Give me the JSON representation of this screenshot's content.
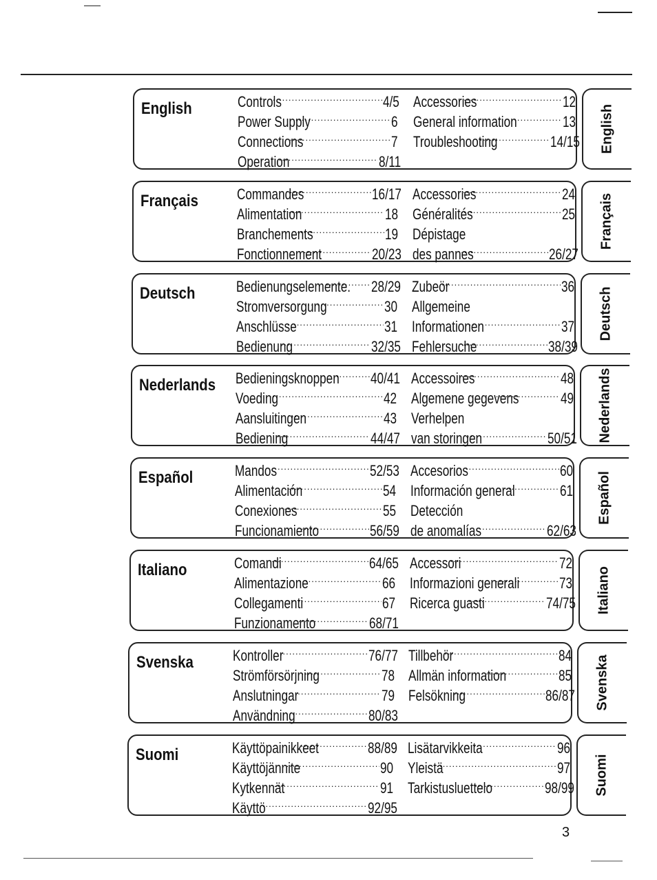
{
  "page_number": "3",
  "sections": [
    {
      "lang": "English",
      "tab": "English",
      "col1": [
        {
          "label": "Controls",
          "page": "4/5"
        },
        {
          "label": "Power Supply",
          "page": "6"
        },
        {
          "label": "Connections",
          "page": "7"
        },
        {
          "label": "Operation",
          "page": "8/11"
        }
      ],
      "col2": [
        {
          "label": "Accessories",
          "page": "12"
        },
        {
          "label": "General information",
          "page": "13"
        },
        {
          "label": "Troubleshooting",
          "page": "14/15"
        }
      ]
    },
    {
      "lang": "Français",
      "tab": "Français",
      "col1": [
        {
          "label": "Commandes",
          "page": "16/17"
        },
        {
          "label": "Alimentation",
          "page": "18"
        },
        {
          "label": "Branchements",
          "page": "19"
        },
        {
          "label": "Fonctionnement",
          "page": "20/23"
        }
      ],
      "col2": [
        {
          "label": "Accessories",
          "page": "24"
        },
        {
          "label": "Généralités",
          "page": "25"
        },
        {
          "label": "Dépistage",
          "page": ""
        },
        {
          "label": "des pannes",
          "page": "26/27"
        }
      ]
    },
    {
      "lang": "Deutsch",
      "tab": "Deutsch",
      "col1": [
        {
          "label": "Bedienungselemente.",
          "page": "28/29"
        },
        {
          "label": "Stromversorgung",
          "page": "30"
        },
        {
          "label": "Anschlüsse",
          "page": "31"
        },
        {
          "label": "Bedienung",
          "page": "32/35"
        }
      ],
      "col2": [
        {
          "label": "Zubeör",
          "page": "36"
        },
        {
          "label": "Allgemeine",
          "page": ""
        },
        {
          "label": "Informationen",
          "page": "37"
        },
        {
          "label": "Fehlersuche",
          "page": "38/39"
        }
      ]
    },
    {
      "lang": "Nederlands",
      "tab": "Nederlands",
      "col1": [
        {
          "label": "Bedieningsknoppen",
          "page": "40/41"
        },
        {
          "label": "Voeding",
          "page": "42"
        },
        {
          "label": "Aansluitingen",
          "page": "43"
        },
        {
          "label": "Bediening",
          "page": "44/47"
        }
      ],
      "col2": [
        {
          "label": "Accessoires",
          "page": "48"
        },
        {
          "label": "Algemene gegevens",
          "page": "49"
        },
        {
          "label": "Verhelpen",
          "page": ""
        },
        {
          "label": "van storingen",
          "page": "50/51"
        }
      ]
    },
    {
      "lang": "Español",
      "tab": "Español",
      "col1": [
        {
          "label": "Mandos",
          "page": "52/53"
        },
        {
          "label": "Alimentación",
          "page": "54"
        },
        {
          "label": "Conexiones",
          "page": "55"
        },
        {
          "label": "Funcionamiento",
          "page": "56/59"
        }
      ],
      "col2": [
        {
          "label": "Accesorios",
          "page": "60"
        },
        {
          "label": "Información general",
          "page": "61"
        },
        {
          "label": "Detección",
          "page": ""
        },
        {
          "label": "de anomalías",
          "page": "62/63"
        }
      ]
    },
    {
      "lang": "Italiano",
      "tab": "Italiano",
      "col1": [
        {
          "label": "Comandi",
          "page": "64/65"
        },
        {
          "label": "Alimentazione",
          "page": "66"
        },
        {
          "label": "Collegamenti",
          "page": "67"
        },
        {
          "label": "Funzionamento",
          "page": "68/71"
        }
      ],
      "col2": [
        {
          "label": "Accessori",
          "page": "72"
        },
        {
          "label": "Informazioni generali",
          "page": "73"
        },
        {
          "label": "Ricerca guasti",
          "page": "74/75"
        }
      ]
    },
    {
      "lang": "Svenska",
      "tab": "Svenska",
      "col1": [
        {
          "label": "Kontroller",
          "page": "76/77"
        },
        {
          "label": "Strömförsörjning",
          "page": "78"
        },
        {
          "label": "Anslutningar",
          "page": "79"
        },
        {
          "label": "Användning",
          "page": "80/83"
        }
      ],
      "col2": [
        {
          "label": "Tillbehör",
          "page": "84"
        },
        {
          "label": "Allmän information",
          "page": "85"
        },
        {
          "label": "Felsökning",
          "page": "86/87"
        }
      ]
    },
    {
      "lang": "Suomi",
      "tab": "Suomi",
      "col1": [
        {
          "label": "Käyttöpainikkeet",
          "page": "88/89"
        },
        {
          "label": "Käyttöjännite",
          "page": "90"
        },
        {
          "label": "Kytkennät",
          "page": "91"
        },
        {
          "label": "Käyttö",
          "page": "92/95"
        }
      ],
      "col2": [
        {
          "label": "Lisätarvikkeita",
          "page": "96"
        },
        {
          "label": "Yleistä",
          "page": "97"
        },
        {
          "label": "Tarkistusluettelo",
          "page": "98/99"
        }
      ]
    }
  ]
}
